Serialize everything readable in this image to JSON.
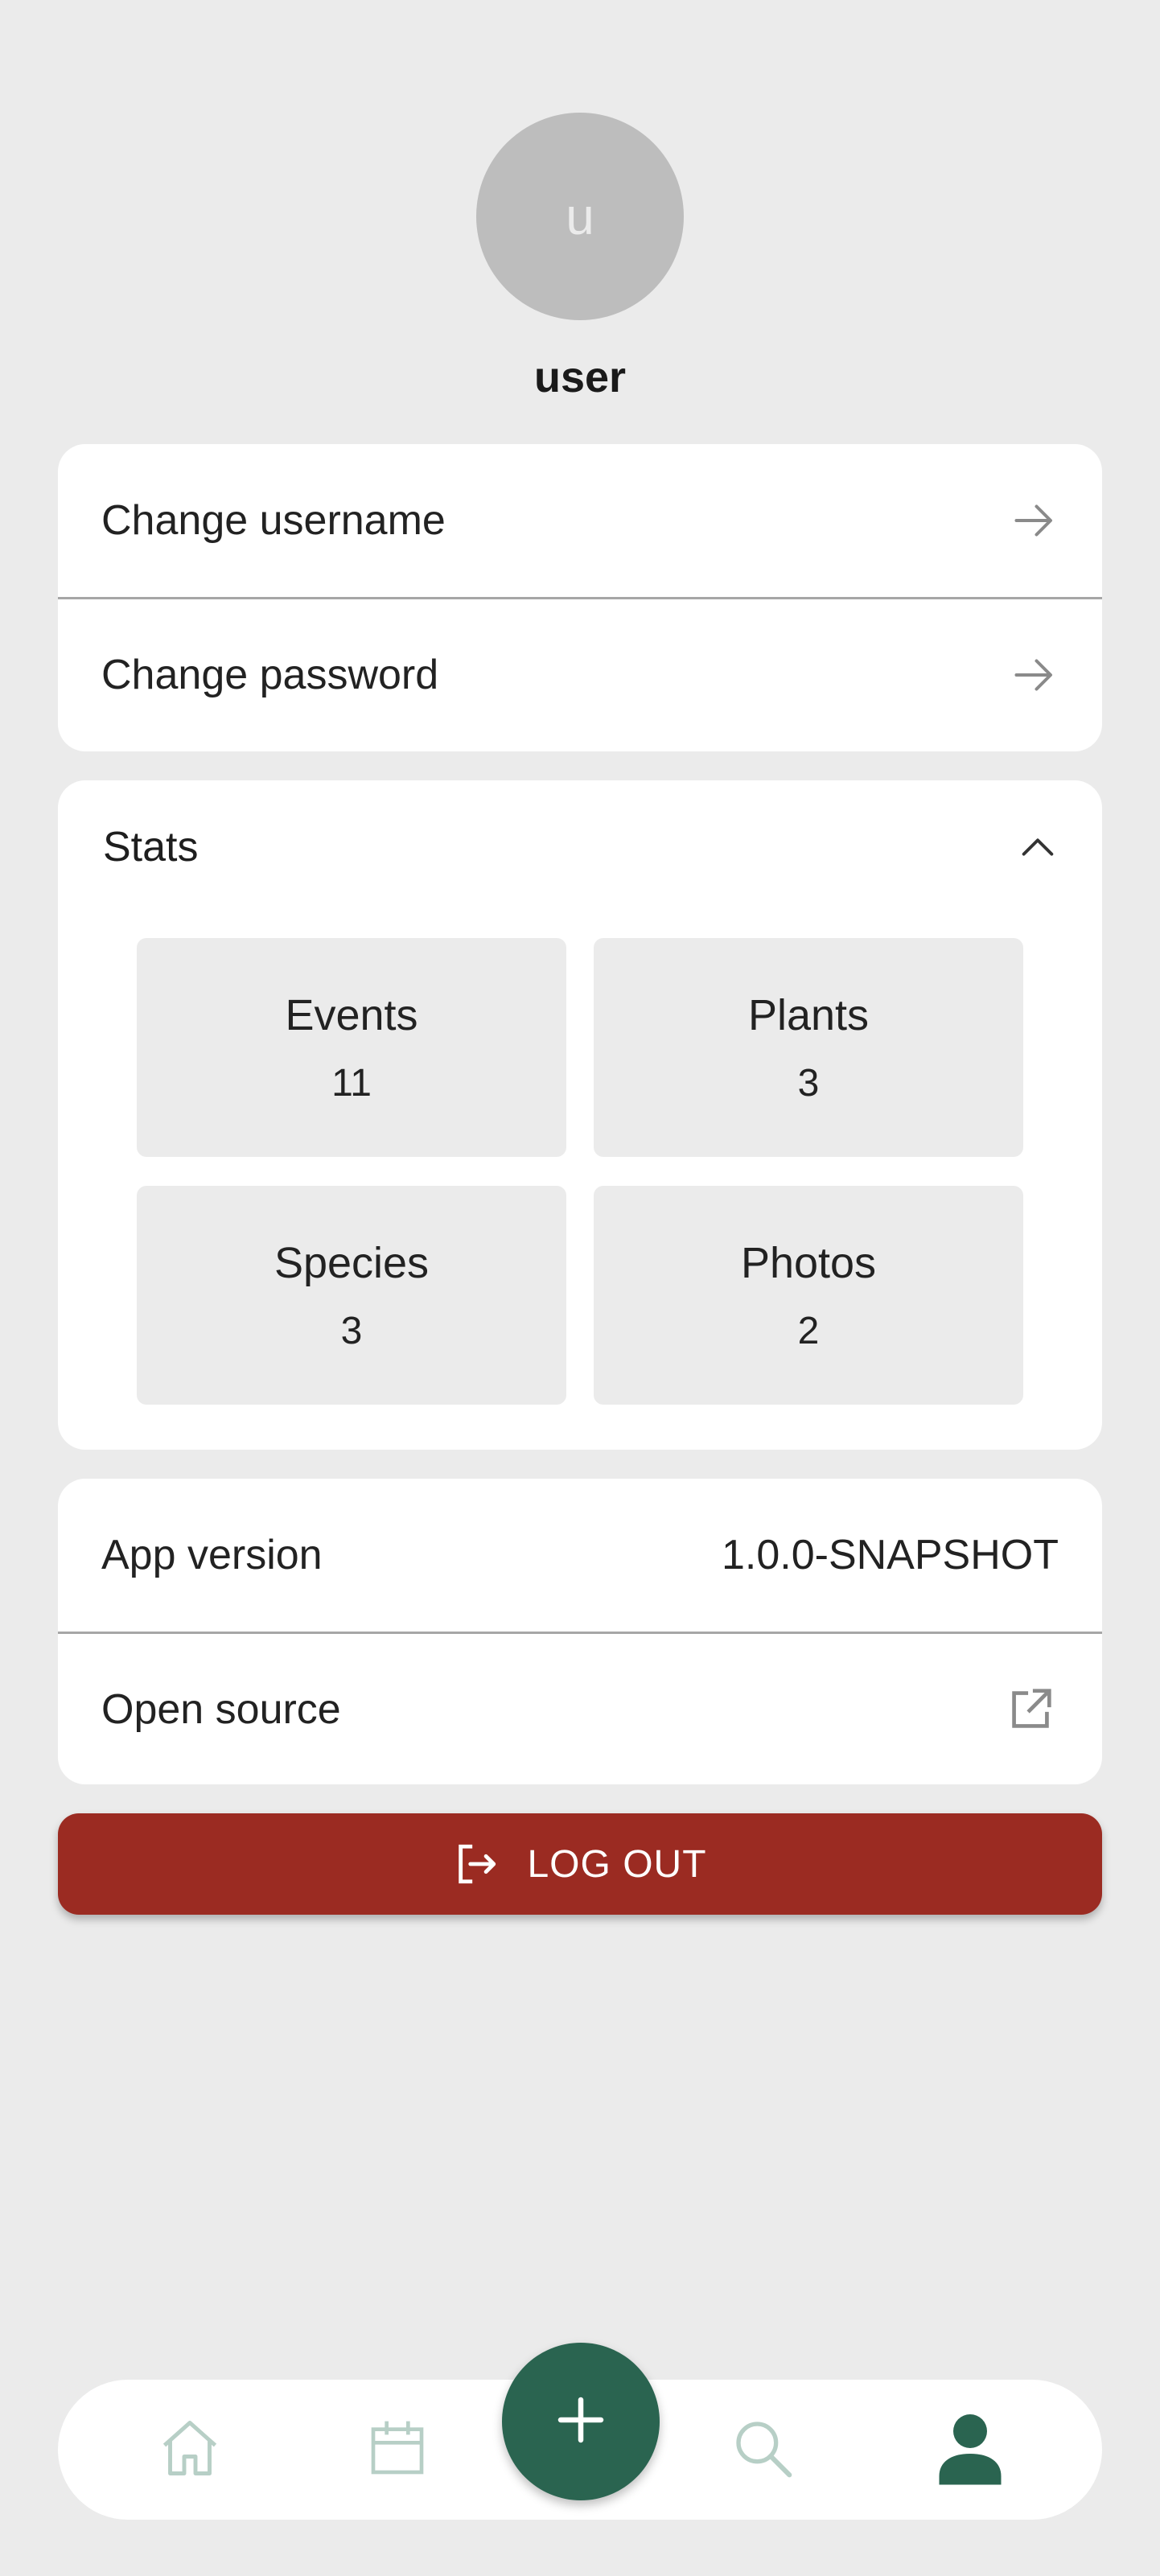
{
  "profile": {
    "avatar_initial": "u",
    "username": "user"
  },
  "account": {
    "change_username": "Change username",
    "change_password": "Change password"
  },
  "stats": {
    "title": "Stats",
    "tiles": [
      {
        "label": "Events",
        "value": "11"
      },
      {
        "label": "Plants",
        "value": "3"
      },
      {
        "label": "Species",
        "value": "3"
      },
      {
        "label": "Photos",
        "value": "2"
      }
    ]
  },
  "about": {
    "app_version_label": "App version",
    "app_version_value": "1.0.0-SNAPSHOT",
    "open_source_label": "Open source"
  },
  "logout": {
    "label": "LOG OUT"
  },
  "nav": {
    "items": [
      "home-icon",
      "calendar-icon",
      "add-icon",
      "search-icon",
      "profile-icon"
    ],
    "active": "profile-icon"
  },
  "colors": {
    "background": "#ebebeb",
    "card": "#ffffff",
    "accent_green": "#2a6450",
    "inactive_icon": "#b7cfc6",
    "logout_red": "#9b2b22",
    "tile": "#ebebeb"
  }
}
